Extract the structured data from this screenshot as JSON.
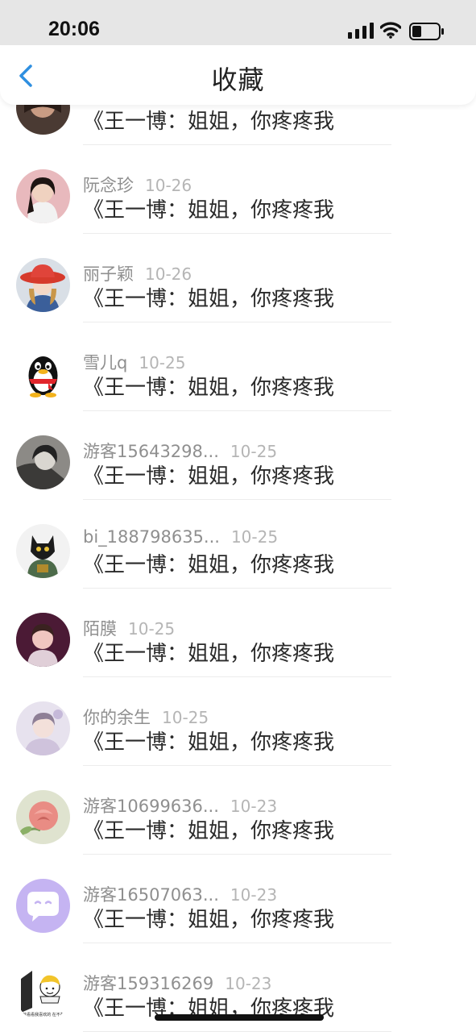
{
  "status_bar": {
    "time": "20:06"
  },
  "header": {
    "title": "收藏",
    "back_icon": "chevron-left-icon"
  },
  "colors": {
    "accent": "#2f8fe0",
    "author": "#8f8f8f",
    "date": "#b5b5b5",
    "message": "#2a2a2a"
  },
  "items": [
    {
      "author": "",
      "date": "",
      "message": "《王一博：姐姐，你疼疼我",
      "avatar": "portrait-dark"
    },
    {
      "author": "阮念珍",
      "date": "10-26",
      "message": "《王一博：姐姐，你疼疼我",
      "avatar": "portrait-girl"
    },
    {
      "author": "丽子颖",
      "date": "10-26",
      "message": "《王一博：姐姐，你疼疼我",
      "avatar": "portrait-red-hat"
    },
    {
      "author": "雪儿q",
      "date": "10-25",
      "message": "《王一博：姐姐，你疼疼我",
      "avatar": "qq-penguin"
    },
    {
      "author": "游客15643298...",
      "date": "10-25",
      "message": "《王一博：姐姐，你疼疼我",
      "avatar": "portrait-bw"
    },
    {
      "author": "bi_188798635...",
      "date": "10-25",
      "message": "《王一博：姐姐，你疼疼我",
      "avatar": "cat-figure"
    },
    {
      "author": "陌膜",
      "date": "10-25",
      "message": "《王一博：姐姐，你疼疼我",
      "avatar": "portrait-pink"
    },
    {
      "author": "你的余生",
      "date": "10-25",
      "message": "《王一博：姐姐，你疼疼我",
      "avatar": "portrait-light"
    },
    {
      "author": "游客10699636...",
      "date": "10-23",
      "message": "《王一博：姐姐，你疼疼我",
      "avatar": "rose"
    },
    {
      "author": "游客16507063...",
      "date": "10-23",
      "message": "《王一博：姐姐，你疼疼我",
      "avatar": "chat-bubble-icon"
    },
    {
      "author": "游客159316269",
      "date": "10-23",
      "message": "《王一博：姐姐，你疼疼我",
      "avatar": "cartoon-sticker",
      "avatar_caption": "就看看我喜欢的 在不在"
    }
  ]
}
